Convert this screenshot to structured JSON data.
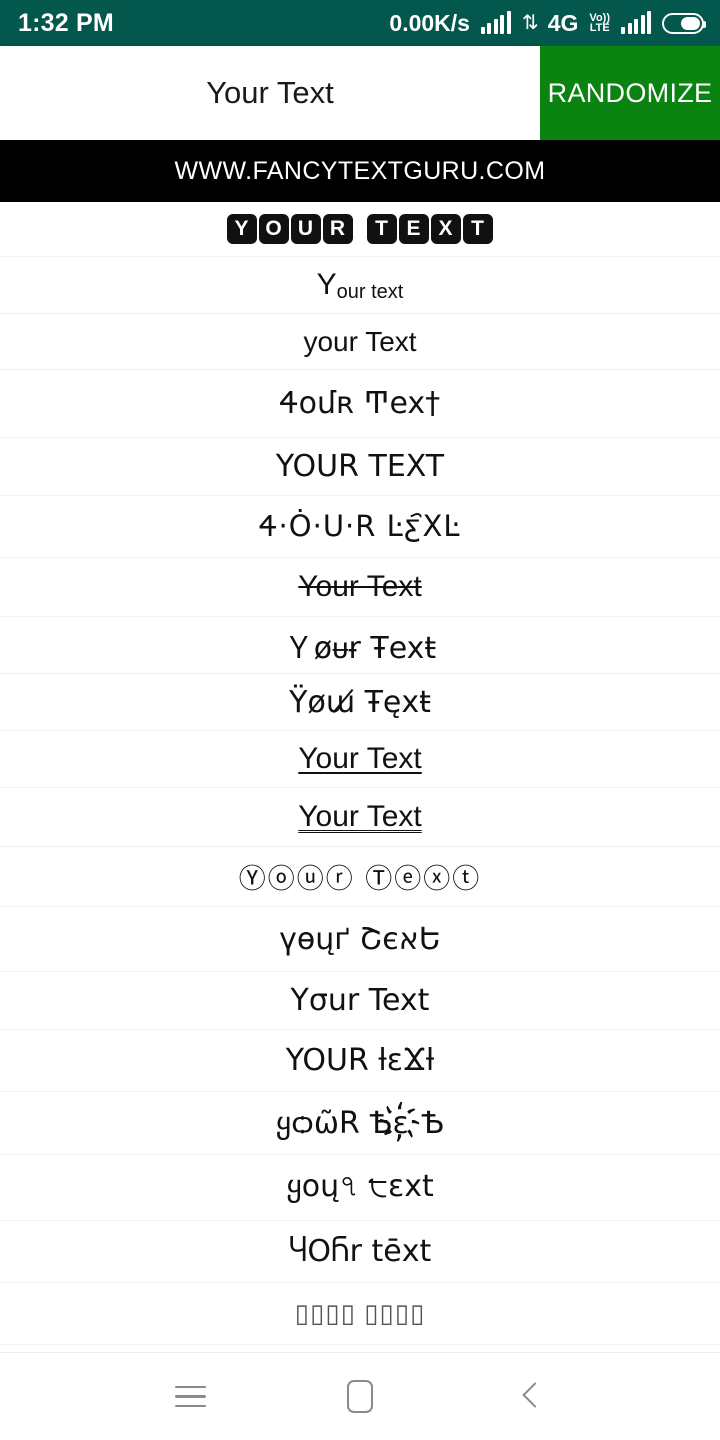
{
  "status_bar": {
    "clock": "1:32 PM",
    "net_speed": "0.00K/s",
    "network_type": "4G",
    "volte_top": "Vo))",
    "volte_bottom": "LTE",
    "data_arrows": "⇅",
    "colors": {
      "background": "#03574c",
      "foreground": "#ffffff"
    }
  },
  "header": {
    "input_value": "Your Text",
    "input_placeholder": "Your Text",
    "randomize_label": "RANDOMIZE",
    "randomize_color": "#0a8311"
  },
  "ad_banner": {
    "text": "WWW.FANCYTEXTGURU.COM",
    "background": "#000000"
  },
  "results": {
    "items": [
      {
        "id": "boxed",
        "style": "v-box",
        "chars": [
          "Y",
          "O",
          "U",
          "R",
          "T",
          "E",
          "X",
          "T"
        ],
        "space_after": 3,
        "text": "🆈🅾🆄🆁 🆃🅴🆇🆃"
      },
      {
        "id": "subscript",
        "style": "v-sub",
        "lead": "Y",
        "rest": "our text",
        "text": "Yₒᵤᵣ ₜₑₓₜ"
      },
      {
        "id": "inverted-case",
        "style": "v-plain",
        "text": "your Text"
      },
      {
        "id": "unicode-mixed-1",
        "style": "v-uni",
        "text": "Ꮞoմʀ Ͳex†"
      },
      {
        "id": "small-caps",
        "style": "v-uni",
        "text": "YOUR TEXT"
      },
      {
        "id": "dotted-unicode",
        "style": "v-uni2",
        "text": "Ꮞ·Ȯ·U·R Ŀƹ҄ΧĿ"
      },
      {
        "id": "strikethrough",
        "style": "v-strike",
        "text": "Your Text"
      },
      {
        "id": "short-stroke",
        "style": "v-strike2",
        "text": "Ｙøᵾɍ Ŧexŧ"
      },
      {
        "id": "slashed",
        "style": "v-slash",
        "text": "Ÿøɯ̸ Ŧęxŧ"
      },
      {
        "id": "underline",
        "style": "v-under",
        "text": "Your Text"
      },
      {
        "id": "double-underline",
        "style": "v-under2",
        "text": "Your Text"
      },
      {
        "id": "circled",
        "style": "v-circ",
        "text": "Ⓨⓞⓤⓡ Ⓣⓔⓧⓣ"
      },
      {
        "id": "greek-style",
        "style": "v-uni",
        "text": "үөųґ ՇєאԵ"
      },
      {
        "id": "sigma-style",
        "style": "v-uni",
        "text": "Yσur Text"
      },
      {
        "id": "mixed-caps",
        "style": "v-uni",
        "text": "YOUR ƚɛϪƚ"
      },
      {
        "id": "ornate",
        "style": "v-uni",
        "text": "ყѻῶR Ѣɛ҉Ѣ"
      },
      {
        "id": "devanagari-like",
        "style": "v-uni",
        "text": "ყoų৭ ੮ɛxt"
      },
      {
        "id": "macron-style",
        "style": "v-uni",
        "text": "ႷOႬr tēxt"
      },
      {
        "id": "tofu-missing",
        "style": "v-tofu",
        "text": "▯▯▯▯ ▯▯▯▯"
      }
    ]
  },
  "nav_bar": {
    "menu_label": "Menu",
    "home_label": "Home",
    "back_label": "Back",
    "icon_color": "#8a8a8a"
  }
}
